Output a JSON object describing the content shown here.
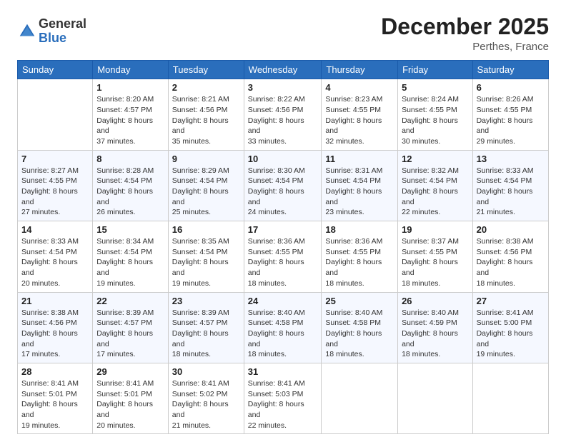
{
  "logo": {
    "general": "General",
    "blue": "Blue"
  },
  "header": {
    "month": "December 2025",
    "location": "Perthes, France"
  },
  "weekdays": [
    "Sunday",
    "Monday",
    "Tuesday",
    "Wednesday",
    "Thursday",
    "Friday",
    "Saturday"
  ],
  "weeks": [
    [
      {
        "day": "",
        "sunrise": "",
        "sunset": "",
        "daylight": ""
      },
      {
        "day": "1",
        "sunrise": "Sunrise: 8:20 AM",
        "sunset": "Sunset: 4:57 PM",
        "daylight": "Daylight: 8 hours and 37 minutes."
      },
      {
        "day": "2",
        "sunrise": "Sunrise: 8:21 AM",
        "sunset": "Sunset: 4:56 PM",
        "daylight": "Daylight: 8 hours and 35 minutes."
      },
      {
        "day": "3",
        "sunrise": "Sunrise: 8:22 AM",
        "sunset": "Sunset: 4:56 PM",
        "daylight": "Daylight: 8 hours and 33 minutes."
      },
      {
        "day": "4",
        "sunrise": "Sunrise: 8:23 AM",
        "sunset": "Sunset: 4:55 PM",
        "daylight": "Daylight: 8 hours and 32 minutes."
      },
      {
        "day": "5",
        "sunrise": "Sunrise: 8:24 AM",
        "sunset": "Sunset: 4:55 PM",
        "daylight": "Daylight: 8 hours and 30 minutes."
      },
      {
        "day": "6",
        "sunrise": "Sunrise: 8:26 AM",
        "sunset": "Sunset: 4:55 PM",
        "daylight": "Daylight: 8 hours and 29 minutes."
      }
    ],
    [
      {
        "day": "7",
        "sunrise": "Sunrise: 8:27 AM",
        "sunset": "Sunset: 4:55 PM",
        "daylight": "Daylight: 8 hours and 27 minutes."
      },
      {
        "day": "8",
        "sunrise": "Sunrise: 8:28 AM",
        "sunset": "Sunset: 4:54 PM",
        "daylight": "Daylight: 8 hours and 26 minutes."
      },
      {
        "day": "9",
        "sunrise": "Sunrise: 8:29 AM",
        "sunset": "Sunset: 4:54 PM",
        "daylight": "Daylight: 8 hours and 25 minutes."
      },
      {
        "day": "10",
        "sunrise": "Sunrise: 8:30 AM",
        "sunset": "Sunset: 4:54 PM",
        "daylight": "Daylight: 8 hours and 24 minutes."
      },
      {
        "day": "11",
        "sunrise": "Sunrise: 8:31 AM",
        "sunset": "Sunset: 4:54 PM",
        "daylight": "Daylight: 8 hours and 23 minutes."
      },
      {
        "day": "12",
        "sunrise": "Sunrise: 8:32 AM",
        "sunset": "Sunset: 4:54 PM",
        "daylight": "Daylight: 8 hours and 22 minutes."
      },
      {
        "day": "13",
        "sunrise": "Sunrise: 8:33 AM",
        "sunset": "Sunset: 4:54 PM",
        "daylight": "Daylight: 8 hours and 21 minutes."
      }
    ],
    [
      {
        "day": "14",
        "sunrise": "Sunrise: 8:33 AM",
        "sunset": "Sunset: 4:54 PM",
        "daylight": "Daylight: 8 hours and 20 minutes."
      },
      {
        "day": "15",
        "sunrise": "Sunrise: 8:34 AM",
        "sunset": "Sunset: 4:54 PM",
        "daylight": "Daylight: 8 hours and 19 minutes."
      },
      {
        "day": "16",
        "sunrise": "Sunrise: 8:35 AM",
        "sunset": "Sunset: 4:54 PM",
        "daylight": "Daylight: 8 hours and 19 minutes."
      },
      {
        "day": "17",
        "sunrise": "Sunrise: 8:36 AM",
        "sunset": "Sunset: 4:55 PM",
        "daylight": "Daylight: 8 hours and 18 minutes."
      },
      {
        "day": "18",
        "sunrise": "Sunrise: 8:36 AM",
        "sunset": "Sunset: 4:55 PM",
        "daylight": "Daylight: 8 hours and 18 minutes."
      },
      {
        "day": "19",
        "sunrise": "Sunrise: 8:37 AM",
        "sunset": "Sunset: 4:55 PM",
        "daylight": "Daylight: 8 hours and 18 minutes."
      },
      {
        "day": "20",
        "sunrise": "Sunrise: 8:38 AM",
        "sunset": "Sunset: 4:56 PM",
        "daylight": "Daylight: 8 hours and 18 minutes."
      }
    ],
    [
      {
        "day": "21",
        "sunrise": "Sunrise: 8:38 AM",
        "sunset": "Sunset: 4:56 PM",
        "daylight": "Daylight: 8 hours and 17 minutes."
      },
      {
        "day": "22",
        "sunrise": "Sunrise: 8:39 AM",
        "sunset": "Sunset: 4:57 PM",
        "daylight": "Daylight: 8 hours and 17 minutes."
      },
      {
        "day": "23",
        "sunrise": "Sunrise: 8:39 AM",
        "sunset": "Sunset: 4:57 PM",
        "daylight": "Daylight: 8 hours and 18 minutes."
      },
      {
        "day": "24",
        "sunrise": "Sunrise: 8:40 AM",
        "sunset": "Sunset: 4:58 PM",
        "daylight": "Daylight: 8 hours and 18 minutes."
      },
      {
        "day": "25",
        "sunrise": "Sunrise: 8:40 AM",
        "sunset": "Sunset: 4:58 PM",
        "daylight": "Daylight: 8 hours and 18 minutes."
      },
      {
        "day": "26",
        "sunrise": "Sunrise: 8:40 AM",
        "sunset": "Sunset: 4:59 PM",
        "daylight": "Daylight: 8 hours and 18 minutes."
      },
      {
        "day": "27",
        "sunrise": "Sunrise: 8:41 AM",
        "sunset": "Sunset: 5:00 PM",
        "daylight": "Daylight: 8 hours and 19 minutes."
      }
    ],
    [
      {
        "day": "28",
        "sunrise": "Sunrise: 8:41 AM",
        "sunset": "Sunset: 5:01 PM",
        "daylight": "Daylight: 8 hours and 19 minutes."
      },
      {
        "day": "29",
        "sunrise": "Sunrise: 8:41 AM",
        "sunset": "Sunset: 5:01 PM",
        "daylight": "Daylight: 8 hours and 20 minutes."
      },
      {
        "day": "30",
        "sunrise": "Sunrise: 8:41 AM",
        "sunset": "Sunset: 5:02 PM",
        "daylight": "Daylight: 8 hours and 21 minutes."
      },
      {
        "day": "31",
        "sunrise": "Sunrise: 8:41 AM",
        "sunset": "Sunset: 5:03 PM",
        "daylight": "Daylight: 8 hours and 22 minutes."
      },
      {
        "day": "",
        "sunrise": "",
        "sunset": "",
        "daylight": ""
      },
      {
        "day": "",
        "sunrise": "",
        "sunset": "",
        "daylight": ""
      },
      {
        "day": "",
        "sunrise": "",
        "sunset": "",
        "daylight": ""
      }
    ]
  ]
}
